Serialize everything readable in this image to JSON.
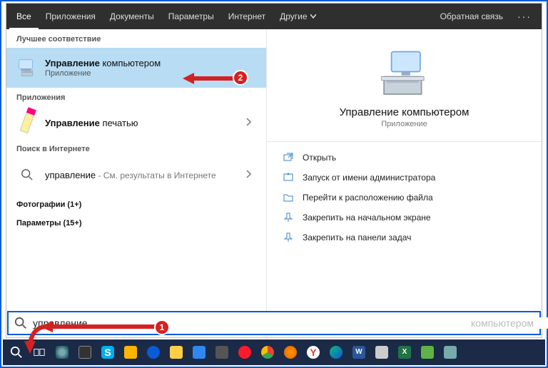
{
  "tabs": {
    "all": "Все",
    "apps": "Приложения",
    "docs": "Документы",
    "params": "Параметры",
    "internet": "Интернет",
    "more": "Другие"
  },
  "feedback": "Обратная связь",
  "left": {
    "best_match": "Лучшее соответствие",
    "result1": {
      "bold": "Управление",
      "rest": " компьютером",
      "sub": "Приложение"
    },
    "apps_header": "Приложения",
    "result2": {
      "bold": "Управление",
      "rest": " печатью"
    },
    "internet_header": "Поиск в Интернете",
    "internet_item": {
      "query": "управление",
      "suffix": " - См. результаты в Интернете"
    },
    "photos": "Фотографии (1+)",
    "params": "Параметры (15+)"
  },
  "preview": {
    "title": "Управление компьютером",
    "sub": "Приложение"
  },
  "actions": {
    "open": "Открыть",
    "admin": "Запуск от имени администратора",
    "location": "Перейти к расположению файла",
    "pin_start": "Закрепить на начальном экране",
    "pin_task": "Закрепить на панели задач"
  },
  "search": {
    "value": "управление",
    "ghost": "компьютером"
  },
  "badges": {
    "one": "1",
    "two": "2"
  }
}
